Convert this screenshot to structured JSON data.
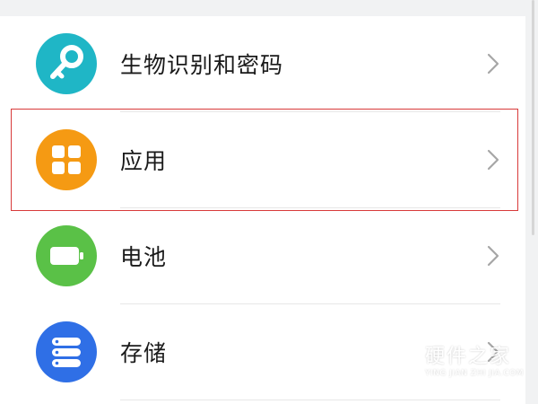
{
  "settings_list": {
    "items": [
      {
        "label": "生物识别和密码",
        "icon": "key-icon",
        "color": "#1fb6c6"
      },
      {
        "label": "应用",
        "icon": "apps-grid-icon",
        "color": "#f59a13"
      },
      {
        "label": "电池",
        "icon": "battery-icon",
        "color": "#5ac147"
      },
      {
        "label": "存储",
        "icon": "storage-icon",
        "color": "#2f6fe6"
      }
    ],
    "highlight_color": "#d83a3a"
  },
  "watermark": {
    "title": "硬件之家",
    "subtitle": "YING JIAN ZHI JIA.COM"
  }
}
